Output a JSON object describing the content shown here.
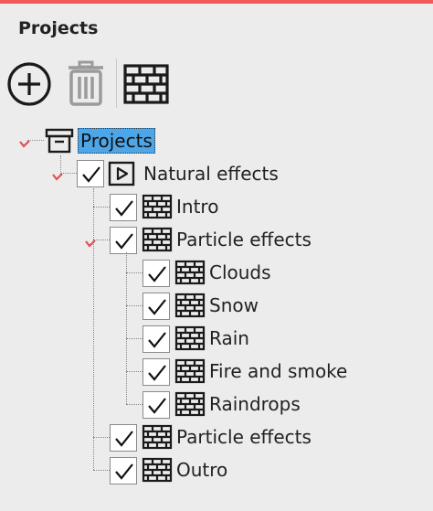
{
  "panel": {
    "title": "Projects"
  },
  "toolbar": {
    "add_icon": "add-circle-icon",
    "delete_icon": "trash-icon",
    "sequence_icon": "brick-wall-icon"
  },
  "tree": {
    "root": {
      "label": "Projects",
      "icon": "archive-box-icon",
      "expanded": true,
      "selected": true
    },
    "show": {
      "label": "Natural effects",
      "icon": "play-box-icon",
      "checked": true,
      "expanded": true
    },
    "children": [
      {
        "label": "Intro",
        "icon": "brick-wall-icon",
        "checked": true
      },
      {
        "label": "Particle effects",
        "icon": "brick-wall-icon",
        "checked": true,
        "expanded": true,
        "children": [
          {
            "label": "Clouds",
            "icon": "brick-wall-icon",
            "checked": true
          },
          {
            "label": "Snow",
            "icon": "brick-wall-icon",
            "checked": true
          },
          {
            "label": "Rain",
            "icon": "brick-wall-icon",
            "checked": true
          },
          {
            "label": "Fire and smoke",
            "icon": "brick-wall-icon",
            "checked": true
          },
          {
            "label": "Raindrops",
            "icon": "brick-wall-icon",
            "checked": true
          }
        ]
      },
      {
        "label": "Particle effects",
        "icon": "brick-wall-icon",
        "checked": true
      },
      {
        "label": "Outro",
        "icon": "brick-wall-icon",
        "checked": true
      }
    ]
  },
  "colors": {
    "accent": "#f05a5a",
    "selection": "#4da6e8",
    "expander": "#e05050"
  }
}
